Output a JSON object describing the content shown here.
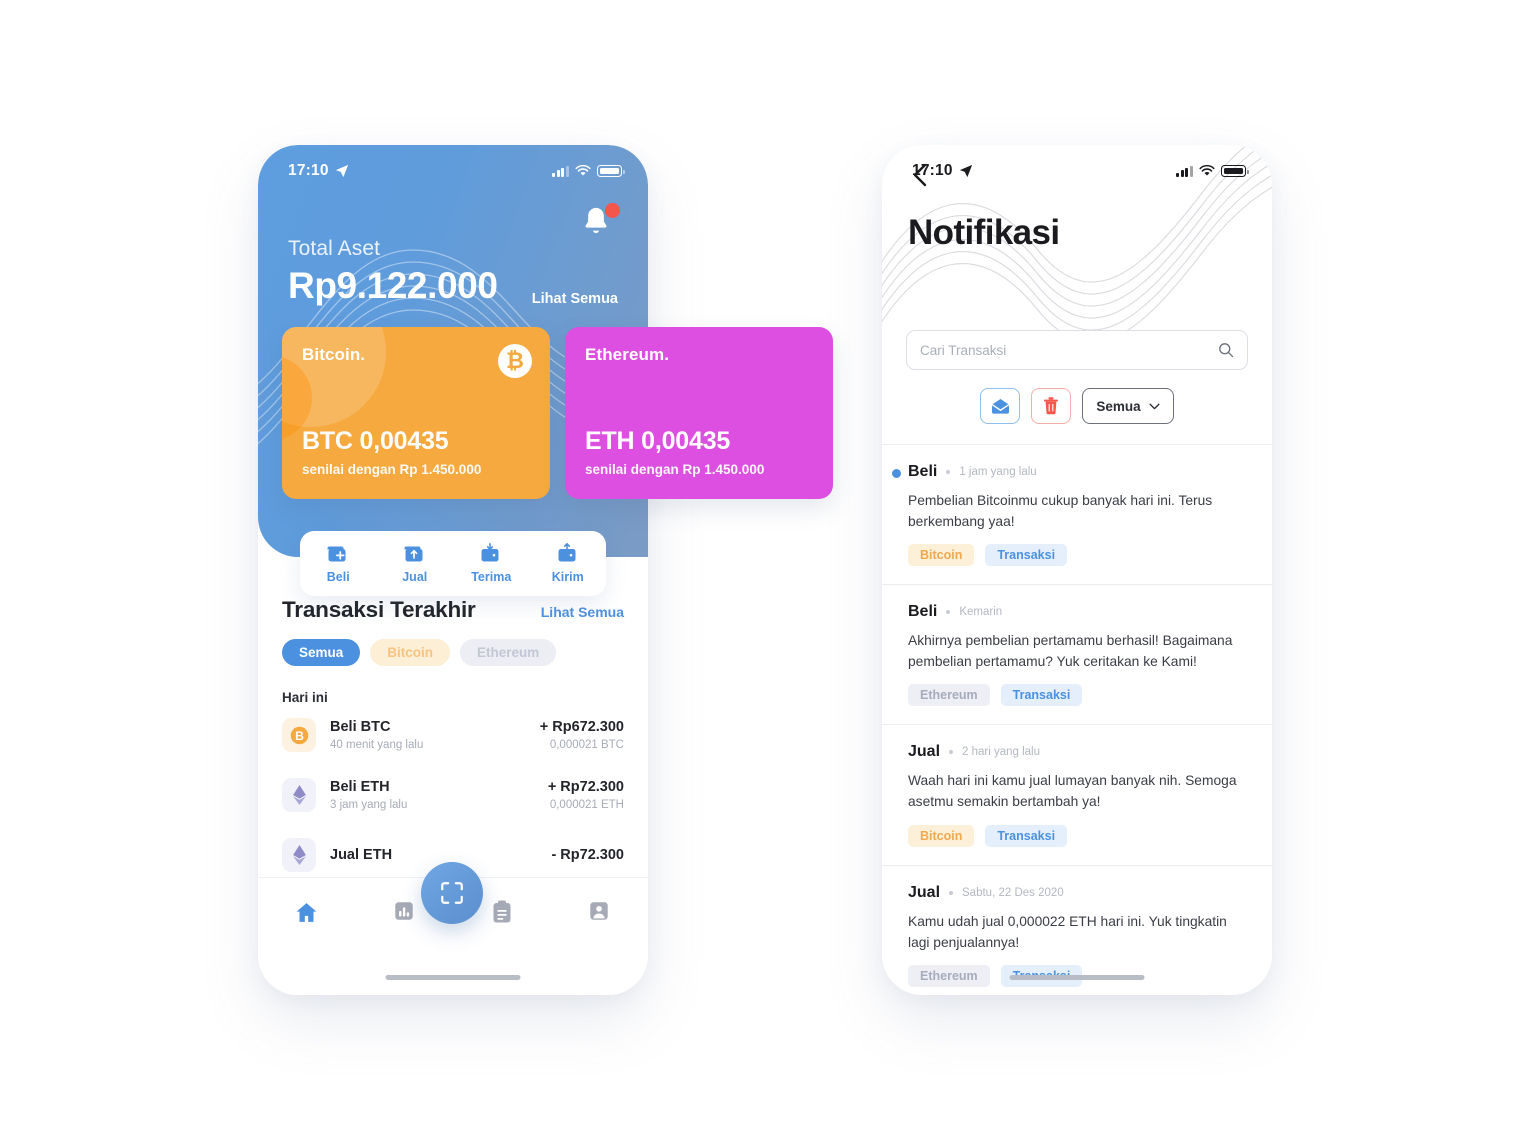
{
  "home": {
    "status": {
      "time": "17:10",
      "location_icon": "location-arrow-icon"
    },
    "header": {
      "total_label": "Total Aset",
      "total_value": "Rp9.122.000",
      "see_all": "Lihat Semua",
      "bell_icon": "bell-icon",
      "has_unread_badge": true
    },
    "coins": [
      {
        "name": "Bitcoin.",
        "symbol": "₿",
        "amount": "BTC 0,00435",
        "subtitle": "senilai dengan Rp 1.450.000",
        "color": "#f6a93f"
      },
      {
        "name": "Ethereum.",
        "symbol": "",
        "amount": "ETH 0,00435",
        "subtitle": "senilai dengan Rp 1.450.000",
        "color": "#dd4fe0"
      }
    ],
    "actions": [
      {
        "label": "Beli",
        "icon": "wallet-plus-icon"
      },
      {
        "label": "Jual",
        "icon": "wallet-up-arrow-icon"
      },
      {
        "label": "Terima",
        "icon": "wallet-receive-icon"
      },
      {
        "label": "Kirim",
        "icon": "wallet-send-icon"
      }
    ],
    "transactions_section": {
      "title": "Transaksi Terakhir",
      "see_all": "Lihat Semua",
      "filters": [
        {
          "label": "Semua",
          "selected": true
        },
        {
          "label": "Bitcoin",
          "selected": false
        },
        {
          "label": "Ethereum",
          "selected": false
        }
      ],
      "group_label": "Hari ini",
      "items": [
        {
          "name": "Beli BTC",
          "time": "40 menit yang lalu",
          "amount": "+ Rp672.300",
          "qty": "0,000021 BTC",
          "coin": "btc"
        },
        {
          "name": "Beli ETH",
          "time": "3 jam yang lalu",
          "amount": "+ Rp72.300",
          "qty": "0,000021 ETH",
          "coin": "eth"
        },
        {
          "name": "Jual ETH",
          "time": "",
          "amount": "- Rp72.300",
          "qty": "",
          "coin": "eth"
        }
      ]
    },
    "fab": {
      "icon": "qr-scan-icon"
    },
    "tabs": [
      {
        "icon": "home-icon",
        "active": true
      },
      {
        "icon": "chart-bar-icon",
        "active": false
      },
      {
        "icon": "clipboard-icon",
        "active": false
      },
      {
        "icon": "person-icon",
        "active": false
      }
    ]
  },
  "notif": {
    "status": {
      "time": "17:10",
      "location_icon": "location-arrow-icon"
    },
    "back_icon": "chevron-left-icon",
    "title": "Notifikasi",
    "search": {
      "placeholder": "Cari Transaksi",
      "value": "",
      "icon": "search-icon"
    },
    "tools": {
      "mail_icon": "mail-open-icon",
      "trash_icon": "trash-icon",
      "filter_label": "Semua",
      "filter_caret": "chevron-down-icon"
    },
    "items": [
      {
        "kind": "Beli",
        "time": "1 jam yang lalu",
        "unread": true,
        "body": "Pembelian Bitcoinmu cukup banyak hari ini. Terus berkembang yaa!",
        "tags": [
          {
            "label": "Bitcoin",
            "style": "bitcoin"
          },
          {
            "label": "Transaksi",
            "style": "transaksi"
          }
        ]
      },
      {
        "kind": "Beli",
        "time": "Kemarin",
        "unread": false,
        "body": "Akhirnya pembelian pertamamu berhasil! Bagaimana pembelian pertamamu? Yuk ceritakan ke Kami!",
        "tags": [
          {
            "label": "Ethereum",
            "style": "ethereum"
          },
          {
            "label": "Transaksi",
            "style": "transaksi"
          }
        ]
      },
      {
        "kind": "Jual",
        "time": "2 hari yang lalu",
        "unread": false,
        "body": "Waah hari ini kamu jual lumayan banyak nih. Semoga asetmu semakin bertambah ya!",
        "tags": [
          {
            "label": "Bitcoin",
            "style": "bitcoin"
          },
          {
            "label": "Transaksi",
            "style": "transaksi"
          }
        ]
      },
      {
        "kind": "Jual",
        "time": "Sabtu, 22 Des 2020",
        "unread": false,
        "body": "Kamu udah jual 0,000022 ETH hari ini. Yuk tingkatin lagi penjualannya!",
        "tags": [
          {
            "label": "Ethereum",
            "style": "ethereum"
          },
          {
            "label": "Transaksi",
            "style": "transaksi"
          }
        ]
      }
    ]
  },
  "colors": {
    "accent_blue": "#4c91e0",
    "bitcoin_orange": "#f6a93f",
    "ethereum_magenta": "#dd4fe0",
    "badge_red": "#f4564c"
  }
}
